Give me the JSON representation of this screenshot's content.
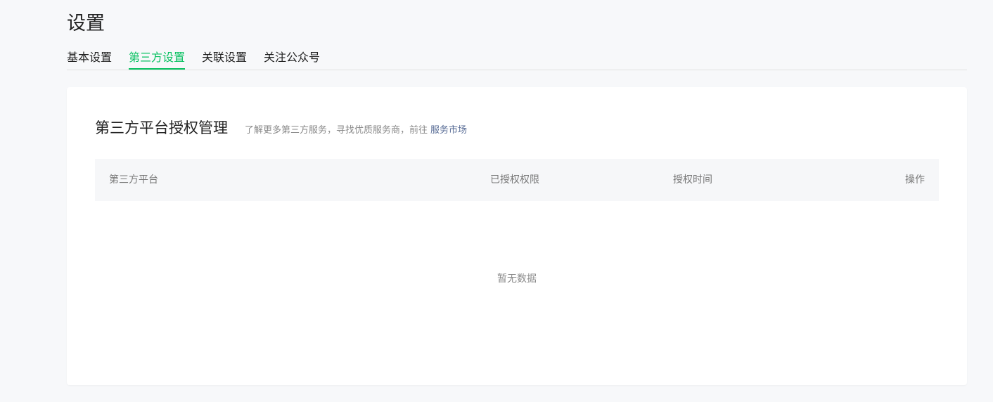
{
  "page": {
    "title": "设置"
  },
  "tabs": [
    {
      "label": "基本设置",
      "active": false
    },
    {
      "label": "第三方设置",
      "active": true
    },
    {
      "label": "关联设置",
      "active": false
    },
    {
      "label": "关注公众号",
      "active": false
    }
  ],
  "card": {
    "title": "第三方平台授权管理",
    "description": "了解更多第三方服务，寻找优质服务商，前往",
    "link_label": "服务市场"
  },
  "table": {
    "columns": [
      "第三方平台",
      "已授权权限",
      "授权时间",
      "操作"
    ],
    "empty_text": "暂无数据"
  },
  "colors": {
    "accent": "#07c160",
    "link": "#576b95",
    "background": "#f7f8fa"
  }
}
